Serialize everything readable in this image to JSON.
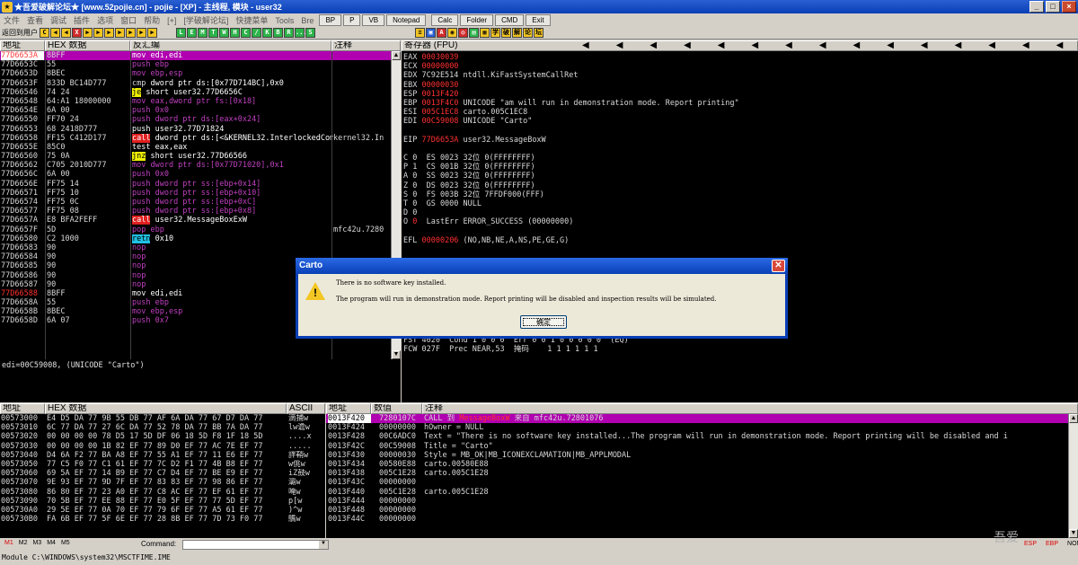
{
  "window": {
    "title": "★吾爱破解论坛★ [www.52pojie.cn] - pojie - [XP] - 主线程, 模块 - user32"
  },
  "menu": {
    "items": [
      "文件",
      "查看",
      "调试",
      "插件",
      "选项",
      "窗口",
      "帮助",
      "[+]",
      "[学破解论坛]",
      "快捷菜单",
      "Tools",
      "Bre"
    ],
    "tools": [
      "BP",
      "P",
      "VB",
      "Notepad",
      "Calc",
      "Folder",
      "CMD",
      "Exit"
    ]
  },
  "toolbar": {
    "label": "返回到用户",
    "icons1": [
      "C",
      "◀",
      "◀",
      "X",
      "▶",
      "▶",
      "▶",
      "▶",
      "▶",
      "▶",
      "▶"
    ],
    "letters": [
      "L",
      "E",
      "M",
      "T",
      "W",
      "H",
      "C",
      "/",
      "K",
      "B",
      "R",
      "...",
      "S"
    ],
    "icons2": [
      "≡",
      "▣",
      "A",
      "◉",
      "◎",
      "▤",
      "▦"
    ],
    "plugins": [
      "学",
      "破",
      "解",
      "论",
      "坛"
    ]
  },
  "disasm": {
    "headers": [
      "地址",
      "HEX 数据",
      "反汇编",
      "注释"
    ],
    "rows": [
      {
        "a": "77D6653A",
        "h": "8BFF",
        "i": "mov edi,edi",
        "k": "mov",
        "c": "",
        "sel": true,
        "ar": true
      },
      {
        "a": "77D6653C",
        "h": "55",
        "i": "push ebp",
        "k": "push",
        "c": ""
      },
      {
        "a": "77D6653D",
        "h": "8BEC",
        "i": "mov ebp,esp",
        "k": "push",
        "c": ""
      },
      {
        "a": "77D6653F",
        "h": "833D BC14D777",
        "i": "cmp dword ptr ds:[0x77D714BC],0x0",
        "k": "cmp",
        "c": ""
      },
      {
        "a": "77D66546",
        "h": "74 24",
        "i": "je short user32.77D6656C",
        "k": "jmp",
        "c": ""
      },
      {
        "a": "77D66548",
        "h": "64:A1 18000000",
        "i": "mov eax,dword ptr fs:[0x18]",
        "k": "push",
        "c": ""
      },
      {
        "a": "77D6654E",
        "h": "6A 00",
        "i": "push 0x0",
        "k": "push",
        "c": ""
      },
      {
        "a": "77D66550",
        "h": "FF70 24",
        "i": "push dword ptr ds:[eax+0x24]",
        "k": "push",
        "c": ""
      },
      {
        "a": "77D66553",
        "h": "68 2418D777",
        "i": "push user32.77D71824",
        "k": "mov",
        "c": ""
      },
      {
        "a": "77D66558",
        "h": "FF15 C412D177",
        "i": "call dword ptr ds:[<&KERNEL32.InterlockedCompare",
        "k": "call",
        "c": "kernel32.In"
      },
      {
        "a": "77D6655E",
        "h": "85C0",
        "i": "test eax,eax",
        "k": "mov",
        "c": ""
      },
      {
        "a": "77D66560",
        "h": "75 0A",
        "i": "jnz short user32.77D66566",
        "k": "jmp",
        "c": ""
      },
      {
        "a": "77D66562",
        "h": "C705 2010D777",
        "i": "mov dword ptr ds:[0x77D71020],0x1",
        "k": "push",
        "c": ""
      },
      {
        "a": "77D6656C",
        "h": "6A 00",
        "i": "push 0x0",
        "k": "push",
        "c": ""
      },
      {
        "a": "77D6656E",
        "h": "FF75 14",
        "i": "push dword ptr ss:[ebp+0x14]",
        "k": "push",
        "c": ""
      },
      {
        "a": "77D66571",
        "h": "FF75 10",
        "i": "push dword ptr ss:[ebp+0x10]",
        "k": "push",
        "c": ""
      },
      {
        "a": "77D66574",
        "h": "FF75 0C",
        "i": "push dword ptr ss:[ebp+0xC]",
        "k": "push",
        "c": ""
      },
      {
        "a": "77D66577",
        "h": "FF75 08",
        "i": "push dword ptr ss:[ebp+0x8]",
        "k": "push",
        "c": ""
      },
      {
        "a": "77D6657A",
        "h": "E8 BFA2FEFF",
        "i": "call user32.MessageBoxExW",
        "k": "call",
        "c": ""
      },
      {
        "a": "77D6657F",
        "h": "5D",
        "i": "pop ebp",
        "k": "push",
        "c": "mfc42u.7280"
      },
      {
        "a": "77D66580",
        "h": "C2 1000",
        "i": "retn 0x10",
        "k": "ret",
        "c": ""
      },
      {
        "a": "77D66583",
        "h": "90",
        "i": "nop",
        "k": "push",
        "c": ""
      },
      {
        "a": "77D66584",
        "h": "90",
        "i": "nop",
        "k": "push",
        "c": ""
      },
      {
        "a": "77D66585",
        "h": "90",
        "i": "nop",
        "k": "push",
        "c": ""
      },
      {
        "a": "77D66586",
        "h": "90",
        "i": "nop",
        "k": "push",
        "c": ""
      },
      {
        "a": "77D66587",
        "h": "90",
        "i": "nop",
        "k": "push",
        "c": ""
      },
      {
        "a": "77D66588",
        "h": "8BFF",
        "i": "mov edi,edi",
        "k": "mov",
        "c": "",
        "ar": true
      },
      {
        "a": "77D6658A",
        "h": "55",
        "i": "push ebp",
        "k": "push",
        "c": ""
      },
      {
        "a": "77D6658B",
        "h": "8BEC",
        "i": "mov ebp,esp",
        "k": "push",
        "c": ""
      },
      {
        "a": "77D6658D",
        "h": "6A 07",
        "i": "push 0x7",
        "k": "push",
        "c": ""
      }
    ],
    "info": "edi=00C59008, (UNICODE \"Carto\")"
  },
  "registers": {
    "header": "寄存器 (FPU)",
    "lines": [
      {
        "t": "EAX 00030039",
        "c": "red"
      },
      {
        "t": "ECX 00000000",
        "c": "red"
      },
      {
        "t": "EDX 7C92E514 ntdll.KiFastSystemCallRet",
        "c": ""
      },
      {
        "t": "EBX 00000030",
        "c": "red"
      },
      {
        "t": "ESP 0013F420",
        "c": "red"
      },
      {
        "t": "EBP 0013F4C0 UNICODE \"am will run in demonstration mode. Report printing\"",
        "c": "red"
      },
      {
        "t": "ESI 005C1EC8 carto.005C1EC8",
        "c": "red"
      },
      {
        "t": "EDI 00C59008 UNICODE \"Carto\"",
        "c": "red"
      },
      {
        "t": "",
        "c": ""
      },
      {
        "t": "EIP 77D6653A user32.MessageBoxW",
        "c": "red"
      },
      {
        "t": "",
        "c": ""
      },
      {
        "t": "C 0  ES 0023 32位 0(FFFFFFFF)",
        "c": ""
      },
      {
        "t": "P 1  CS 001B 32位 0(FFFFFFFF)",
        "c": ""
      },
      {
        "t": "A 0  SS 0023 32位 0(FFFFFFFF)",
        "c": ""
      },
      {
        "t": "Z 0  DS 0023 32位 0(FFFFFFFF)",
        "c": ""
      },
      {
        "t": "S 0  FS 003B 32位 7FFDF000(FFF)",
        "c": ""
      },
      {
        "t": "T 0  GS 0000 NULL",
        "c": ""
      },
      {
        "t": "D 0",
        "c": ""
      },
      {
        "t": "O 0  LastErr ERROR_SUCCESS (00000000)",
        "c": "red"
      },
      {
        "t": "",
        "c": ""
      },
      {
        "t": "EFL 00000206 (NO,NB,NE,A,NS,PE,GE,G)",
        "c": "red"
      }
    ],
    "fpu": [
      "      3 2 1 0      E S P U O Z D I",
      "FST 4020  Cond 1 0 0 0  Err 0 0 1 0 0 0 0 0  (EQ)",
      "FCW 027F  Prec NEAR,53  掩码    1 1 1 1 1 1"
    ]
  },
  "dump": {
    "headers": [
      "地址",
      "HEX 数据",
      "ASCII"
    ],
    "rows": [
      {
        "a": "00573000",
        "h": "E4 D5 DA 77|9B 55 DB 77|AF 6A DA 77|67 D7 DA 77",
        "s": "滴捕w"
      },
      {
        "a": "00573010",
        "h": "6C 77 DA 77|27 6C DA 77|52 78 DA 77|BB 7A DA 77",
        "s": "lw谵w"
      },
      {
        "a": "00573020",
        "h": "00 00 00 00|78 D5 17 5D|DF 06 18 5D|F8 1F 18 5D",
        "s": "....x"
      },
      {
        "a": "00573030",
        "h": "00 00 00 00|1B 82 EF 77|89 D0 EF 77|AC 7E EF 77",
        "s": "....."
      },
      {
        "a": "00573040",
        "h": "D4 6A F2 77|BA A8 EF 77|55 A1 EF 77|11 E6 EF 77",
        "s": "詊鞘w"
      },
      {
        "a": "00573050",
        "h": "77 C5 F0 77|C1 61 EF 77|7C D2 F1 77|4B B8 EF 77",
        "s": "w佻w"
      },
      {
        "a": "00573060",
        "h": "69 5A EF 77|14 B9 EF 77|C7 D4 EF 77|BE E9 EF 77",
        "s": "iZ鼓w"
      },
      {
        "a": "00573070",
        "h": "9E 93 EF 77|9D 7F EF 77|83 83 EF 77|98 86 EF 77",
        "s": "灞w"
      },
      {
        "a": "00573080",
        "h": "86 80 EF 77|23 A0 EF 77|C8 AC EF 77|EF 61 EF 77",
        "s": "唵w"
      },
      {
        "a": "00573090",
        "h": "70 5B EF 77|EE 88 EF 77|E0 5F EF 77|77 5D EF 77",
        "s": "p[w"
      },
      {
        "a": "005730A0",
        "h": "29 5E EF 77|0A 70 EF 77|79 6F EF 77|A5 61 EF 77",
        "s": ")^w"
      },
      {
        "a": "005730B0",
        "h": "FA 6B EF 77|5F 6E EF 77|28 8B EF 77|7D 73 F0 77",
        "s": "鷌w"
      }
    ]
  },
  "stack": {
    "headers": [
      "地址",
      "数值",
      "注释"
    ],
    "rows": [
      {
        "a": "0013F420",
        "v": "7280107C",
        "c": "CALL 到 MessageBoxW 来自 mfc42u.72801076",
        "sel": true
      },
      {
        "a": "0013F424",
        "v": "00000000",
        "c": "hOwner = NULL"
      },
      {
        "a": "0013F428",
        "v": "00C6ADC0",
        "c": "Text = \"There is no software key installed...The program will run in demonstration mode. Report printing will be disabled and i"
      },
      {
        "a": "0013F42C",
        "v": "00C59008",
        "c": "Title = \"Carto\""
      },
      {
        "a": "0013F430",
        "v": "00000030",
        "c": "Style = MB_OK|MB_ICONEXCLAMATION|MB_APPLMODAL"
      },
      {
        "a": "0013F434",
        "v": "00580E88",
        "c": "carto.00580E88"
      },
      {
        "a": "0013F438",
        "v": "005C1E28",
        "c": "carto.005C1E28"
      },
      {
        "a": "0013F43C",
        "v": "00000000",
        "c": ""
      },
      {
        "a": "0013F440",
        "v": "005C1E28",
        "c": "carto.005C1E28"
      },
      {
        "a": "0013F444",
        "v": "00000000",
        "c": ""
      },
      {
        "a": "0013F448",
        "v": "00000000",
        "c": ""
      },
      {
        "a": "0013F44C",
        "v": "00000000",
        "c": ""
      }
    ]
  },
  "dialog": {
    "title": "Carto",
    "close": "✕",
    "line1": "There is no software key installed.",
    "line2": "The program will run in demonstration mode. Report printing will be disabled and inspection results will be simulated.",
    "ok": "确定"
  },
  "status": {
    "tabs": [
      "M1",
      "M2",
      "M3",
      "M4",
      "M5"
    ],
    "command_label": "Command:",
    "module": "Module C:\\WINDOWS\\system32\\MSCTFIME.IME",
    "right": [
      "ESP",
      "EBP",
      "NONE"
    ],
    "watermark": "吾爱"
  }
}
